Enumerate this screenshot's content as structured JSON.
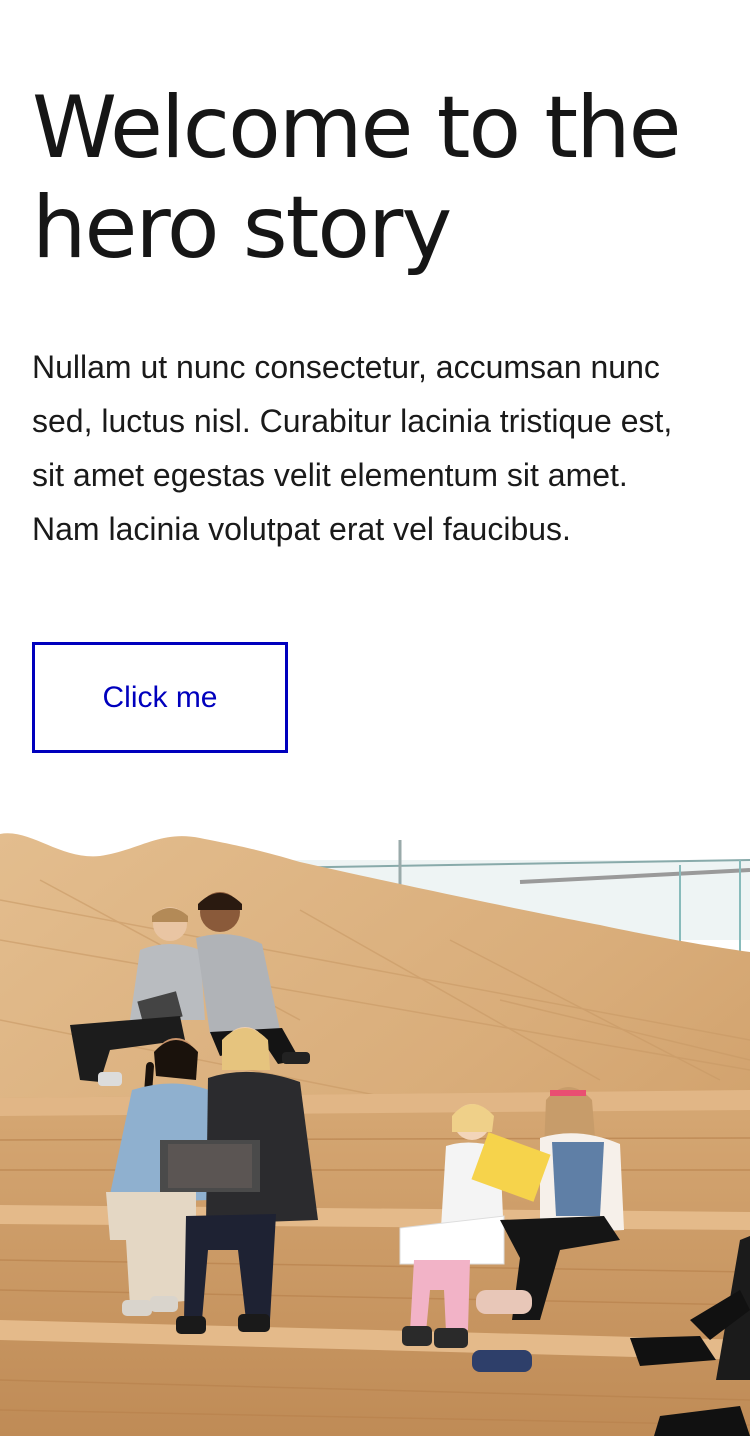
{
  "hero": {
    "title_line1": "Welcome to the",
    "title_line2": "hero story",
    "body": "Nullam ut nunc consectetur, accumsan nunc sed, luctus nisl. Curabitur lacinia tristique est, sit amet egestas velit elementum sit amet. Nam lacinia volutpat erat vel faucibus.",
    "button_label": "Click me"
  },
  "image": {
    "subject": "children-reading-on-wooden-stairs"
  },
  "colors": {
    "accent": "#0000bd",
    "text": "#1a1a1a",
    "wood": "#d7ab78"
  }
}
